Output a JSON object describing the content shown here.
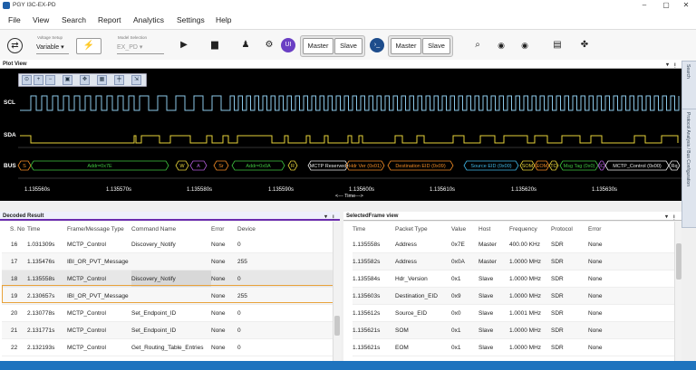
{
  "app": {
    "title": "PGY I3C-EX-PD"
  },
  "menu": [
    "File",
    "View",
    "Search",
    "Report",
    "Analytics",
    "Settings",
    "Help"
  ],
  "toolbar": {
    "voltage_label": "Voltage Setup",
    "voltage_value": "Variable",
    "model_label": "Model Selection",
    "model_value": "EX_PD",
    "ui_label": "UI",
    "master1": "Master",
    "slave1": "Slave",
    "master2": "Master",
    "slave2": "Slave"
  },
  "plot_view": {
    "title": "Plot View",
    "channels": [
      "SCL",
      "SDA",
      "BUS"
    ],
    "bus_labels": [
      "S",
      "Addr=0x7E",
      "W",
      "A",
      "Sr",
      "Addr=0x0A",
      "R",
      "MCTP Reserved",
      "Hdr Ver (0x01)",
      "Destination EID (0x09)",
      "Source EID (0x00)",
      "SOM",
      "EOM",
      "Pkt Seq",
      "TO",
      "Msg Tag (0x0)",
      "IC",
      "MCTP_Control (0x00)",
      "Rq"
    ],
    "time_ticks": [
      "1.135560s",
      "1.135570s",
      "1.135580s",
      "1.135590s",
      "1.135600s",
      "1.135610s",
      "1.135620s",
      "1.135630s"
    ],
    "time_axis_label": "<--- Time--->",
    "colors": {
      "scl": "#8cc8e8",
      "sda": "#e6d23a",
      "bus_white": "#e8e8e8",
      "bus_green": "#3fc43f",
      "bus_orange": "#f08a24",
      "bus_yellow": "#e6d23a",
      "bus_purple": "#b05cd8",
      "bus_cyan": "#3fb8e8"
    }
  },
  "decoded": {
    "title": "Decoded Result",
    "columns": [
      "S. No",
      "Time",
      "Frame/Message Type",
      "Command Name",
      "Error",
      "Device"
    ],
    "rows": [
      [
        "16",
        "1.031309s",
        "MCTP_Control",
        "Discovery_Notify",
        "None",
        "0"
      ],
      [
        "17",
        "1.135476s",
        "IBI_OR_PVT_Message",
        "",
        "None",
        "255"
      ],
      [
        "18",
        "1.135558s",
        "MCTP_Control",
        "Discovery_Notify",
        "None",
        "0"
      ],
      [
        "19",
        "2.130657s",
        "IBI_OR_PVT_Message",
        "",
        "None",
        "255"
      ],
      [
        "20",
        "2.130778s",
        "MCTP_Control",
        "Set_Endpoint_ID",
        "None",
        "0"
      ],
      [
        "21",
        "2.131771s",
        "MCTP_Control",
        "Set_Endpoint_ID",
        "None",
        "0"
      ],
      [
        "22",
        "2.132193s",
        "MCTP_Control",
        "Get_Routing_Table_Entries",
        "None",
        "0"
      ]
    ]
  },
  "selected_frame": {
    "title": "SelectedFrame view",
    "columns": [
      "Time",
      "Packet Type",
      "Value",
      "Host",
      "Frequency",
      "Protocol",
      "Error"
    ],
    "rows": [
      [
        "1.135558s",
        "Address",
        "0x7E",
        "Master",
        "400.00 KHz",
        "SDR",
        "None"
      ],
      [
        "1.135582s",
        "Address",
        "0x0A",
        "Master",
        "1.0000 MHz",
        "SDR",
        "None"
      ],
      [
        "1.135584s",
        "Hdr_Version",
        "0x1",
        "Slave",
        "1.0000 MHz",
        "SDR",
        "None"
      ],
      [
        "1.135603s",
        "Destination_EID",
        "0x9",
        "Slave",
        "1.0000 MHz",
        "SDR",
        "None"
      ],
      [
        "1.135612s",
        "Source_EID",
        "0x0",
        "Slave",
        "1.0001 MHz",
        "SDR",
        "None"
      ],
      [
        "1.135621s",
        "SOM",
        "0x1",
        "Slave",
        "1.0000 MHz",
        "SDR",
        "None"
      ],
      [
        "1.135621s",
        "EOM",
        "0x1",
        "Slave",
        "1.0000 MHz",
        "SDR",
        "None"
      ]
    ]
  },
  "right_tabs": [
    "Search",
    "Protocol Analysis / Bus Configuration"
  ]
}
